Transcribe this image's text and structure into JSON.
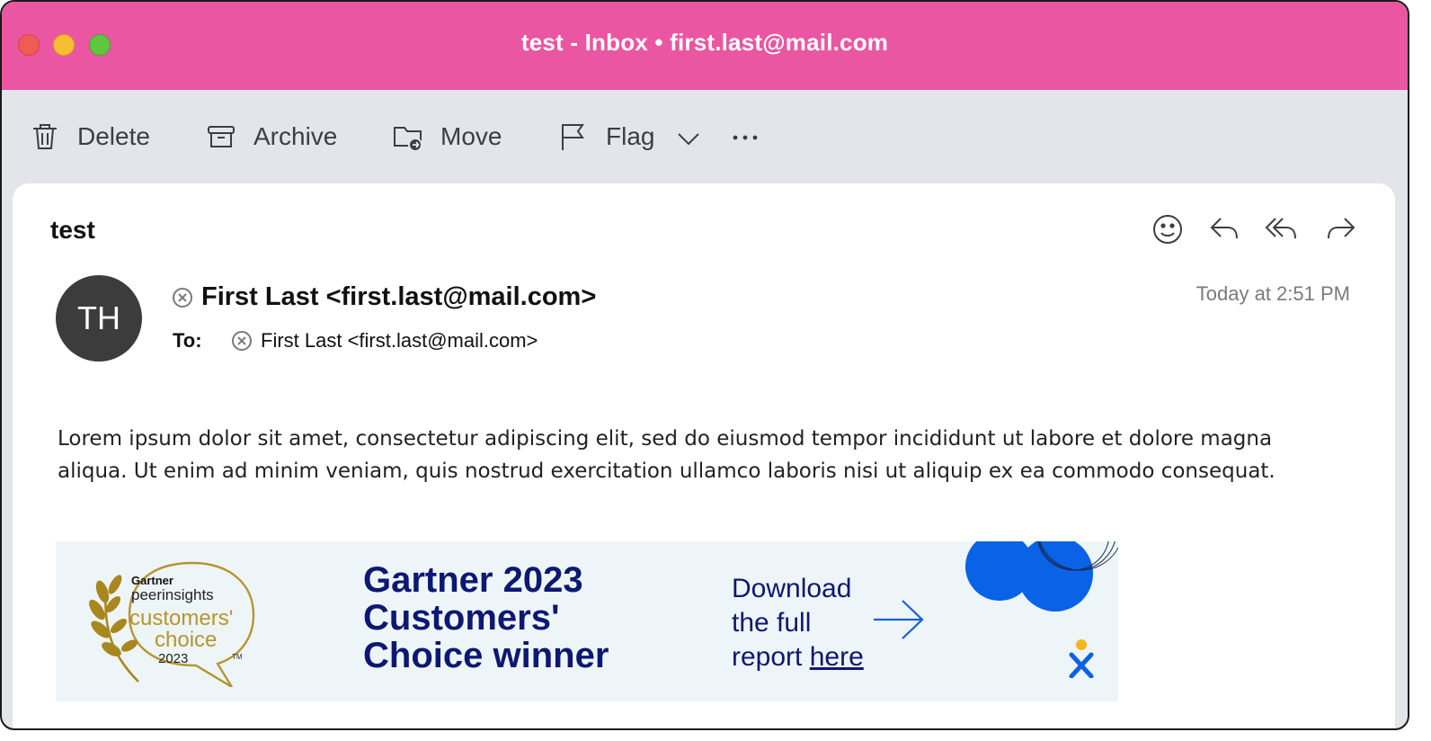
{
  "window": {
    "title": "test - Inbox • first.last@mail.com"
  },
  "toolbar": {
    "delete_label": "Delete",
    "archive_label": "Archive",
    "move_label": "Move",
    "flag_label": "Flag"
  },
  "message": {
    "subject": "test",
    "avatar_initials": "TH",
    "sender": "First Last <first.last@mail.com>",
    "to_label": "To:",
    "to_value": "First Last <first.last@mail.com>",
    "time": "Today at 2:51 PM",
    "body_line1": "Lorem ipsum dolor sit amet, consectetur adipiscing elit, sed do eiusmod tempor incididunt ut labore et dolore magna",
    "body_line2": "aliqua. Ut enim ad minim veniam, quis nostrud exercitation ullamco laboris nisi ut aliquip ex ea commodo consequat."
  },
  "banner": {
    "badge_brand": "Gartner",
    "badge_peer_a": "peer",
    "badge_peer_b": "insights",
    "badge_customers": "customers'",
    "badge_choice": "choice",
    "badge_year": "2023",
    "badge_tm": "TM",
    "headline_1": "Gartner 2023",
    "headline_2": "Customers'",
    "headline_3": "Choice winner",
    "cta_1": "Download",
    "cta_2": "the full",
    "cta_3": "report ",
    "cta_link": "here"
  },
  "colors": {
    "titlebar": "#ea56a1",
    "toolbar_bg": "#e3e5ea",
    "headline": "#0c1872",
    "gold": "#b59530",
    "blob_blue": "#0a62e6"
  }
}
